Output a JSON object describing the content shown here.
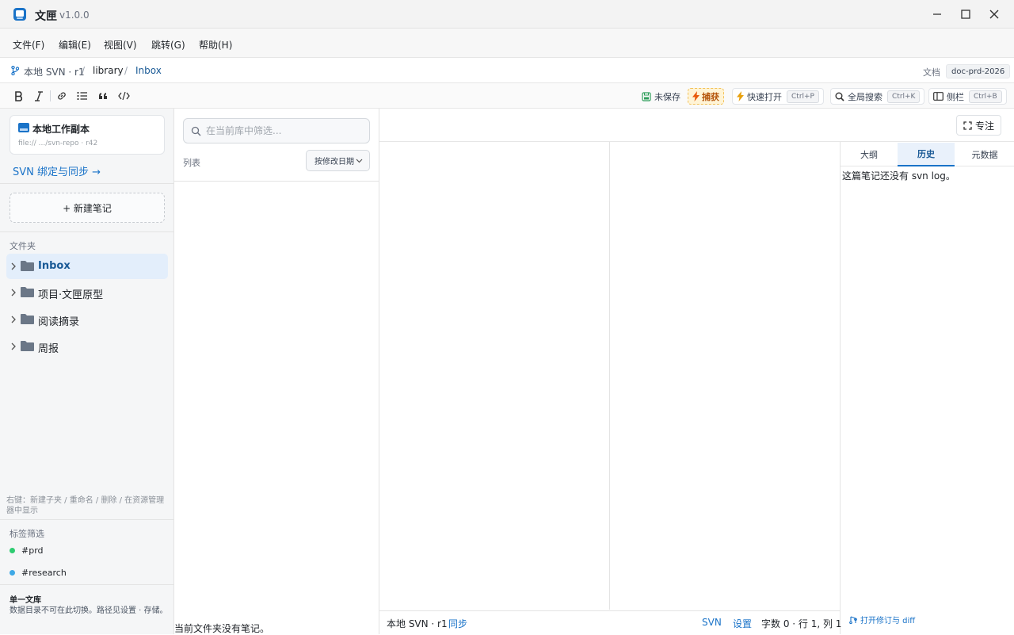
{
  "app": {
    "title": "文匣",
    "version": "v1.0.0"
  },
  "menu": [
    "文件(F)",
    "编辑(E)",
    "视图(V)",
    "跳转(G)",
    "帮助(H)"
  ],
  "breadcrumb": {
    "repo": "本地 SVN · r1",
    "path": [
      "library",
      "Inbox"
    ],
    "doc_label": "文档",
    "doc_id": "doc-prd-2026"
  },
  "toolbar": {
    "unsaved": "未保存",
    "capture": "捕获",
    "quick_open": {
      "label": "快速打开",
      "shortcut": "Ctrl+P"
    },
    "global_search": {
      "label": "全局搜索",
      "shortcut": "Ctrl+K"
    },
    "sidebar": {
      "label": "侧栏",
      "shortcut": "Ctrl+B"
    }
  },
  "sidebar": {
    "repo": {
      "title": "本地工作副本",
      "path": "file:// .../svn-repo · r42"
    },
    "svn_bind": "SVN 绑定与同步 →",
    "new_note": "+ 新建笔记",
    "folders_label": "文件夹",
    "folders": [
      {
        "name": "Inbox",
        "active": true
      },
      {
        "name": "项目·文匣原型",
        "active": false
      },
      {
        "name": "阅读摘录",
        "active": false
      },
      {
        "name": "周报",
        "active": false
      }
    ],
    "context_hint": "右键：新建子夹 / 重命名 / 删除 / 在资源管理器中显示",
    "tags_label": "标签筛选",
    "tags": [
      {
        "name": "#prd",
        "color": "#2ecc71"
      },
      {
        "name": "#research",
        "color": "#3fa9e6"
      }
    ],
    "library": {
      "title": "单一文库",
      "desc": "数据目录不可在此切换。路径见设置 · 存储。"
    }
  },
  "notelist": {
    "filter_placeholder": "在当前库中筛选...",
    "list_label": "列表",
    "sort": "按修改日期",
    "empty": "当前文件夹没有笔记。"
  },
  "editor": {
    "focus": "专注"
  },
  "right_panel": {
    "tabs": [
      "大纲",
      "历史",
      "元数据"
    ],
    "active_tab": "历史",
    "history_empty": "这篇笔记还没有 svn log。",
    "open_diff": "打开修订与 diff"
  },
  "statusbar": {
    "repo": "本地 SVN · r1",
    "sync": "同步",
    "svn": "SVN",
    "settings": "设置",
    "position": "字数 0 · 行 1, 列 1"
  },
  "colors": {
    "accent": "#1a73c8",
    "capture_bg": "#fff4d6",
    "capture_fg": "#b45309"
  }
}
